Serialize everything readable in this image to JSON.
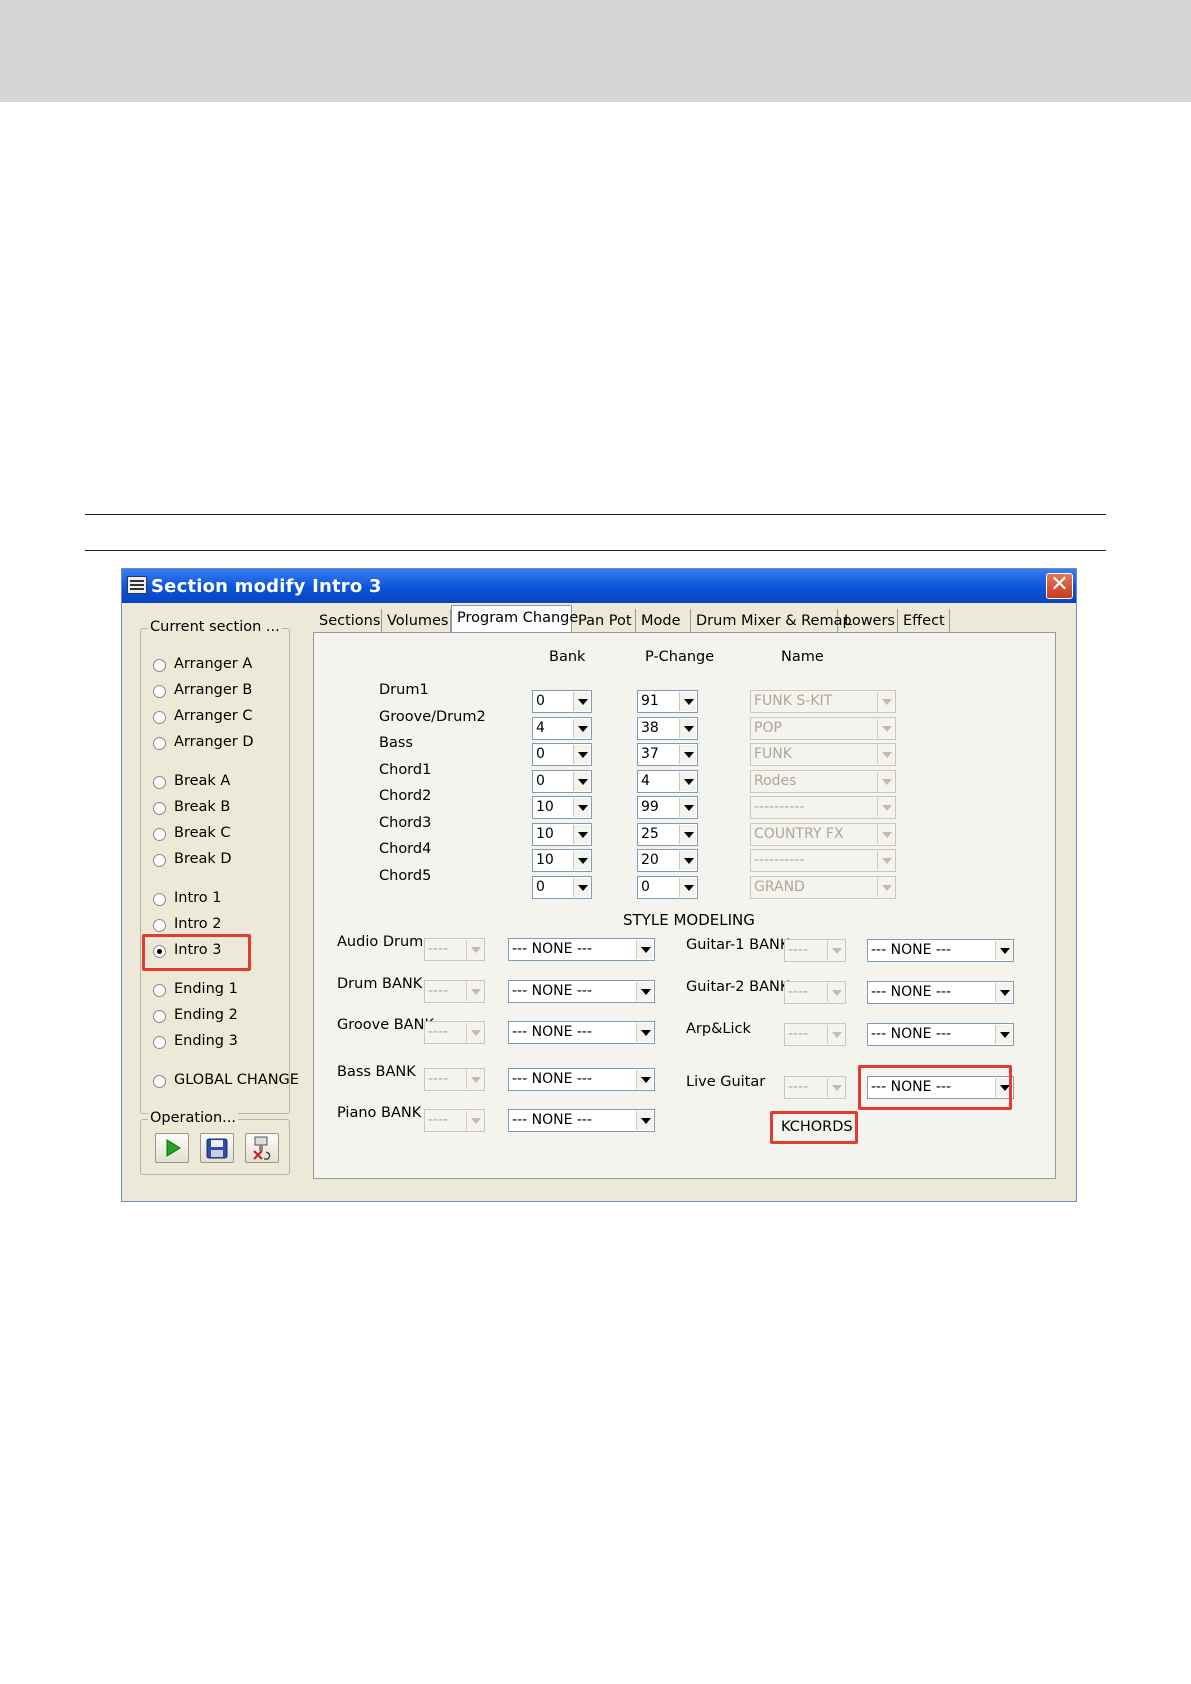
{
  "window": {
    "title": "Section modify Intro 3",
    "close_label": "✕"
  },
  "current_section": {
    "legend": "Current section ...",
    "selected": "Intro 3",
    "options": [
      "Arranger A",
      "Arranger B",
      "Arranger C",
      "Arranger D",
      "Break A",
      "Break B",
      "Break C",
      "Break D",
      "Intro 1",
      "Intro 2",
      "Intro 3",
      "Ending 1",
      "Ending 2",
      "Ending 3",
      "GLOBAL CHANGE"
    ]
  },
  "operation": {
    "legend": "Operation...",
    "buttons": [
      "play-icon",
      "save-icon",
      "delete-icon"
    ]
  },
  "tabs": [
    "Sections",
    "Volumes",
    "Program Change",
    "Pan Pot",
    "Mode",
    "Drum Mixer & Remap",
    "Lowers",
    "Effect"
  ],
  "active_tab": "Program Change",
  "program_change": {
    "headers": {
      "bank": "Bank",
      "pchange": "P-Change",
      "name": "Name"
    },
    "rows": [
      {
        "label": "Drum1",
        "bank": "0",
        "pchange": "91",
        "name": "FUNK S-KIT"
      },
      {
        "label": "Groove/Drum2",
        "bank": "4",
        "pchange": "38",
        "name": "POP"
      },
      {
        "label": "Bass",
        "bank": "0",
        "pchange": "37",
        "name": "FUNK"
      },
      {
        "label": "Chord1",
        "bank": "0",
        "pchange": "4",
        "name": "Rodes"
      },
      {
        "label": "Chord2",
        "bank": "10",
        "pchange": "99",
        "name": "----------"
      },
      {
        "label": "Chord3",
        "bank": "10",
        "pchange": "25",
        "name": "COUNTRY FX"
      },
      {
        "label": "Chord4",
        "bank": "10",
        "pchange": "20",
        "name": "----------"
      },
      {
        "label": "Chord5",
        "bank": "0",
        "pchange": "0",
        "name": "GRAND"
      }
    ]
  },
  "style_modeling": {
    "title": "STYLE MODELING",
    "left": [
      {
        "label": "Audio Drum",
        "small": "----",
        "value": "--- NONE ---"
      },
      {
        "label": "Drum BANK",
        "small": "----",
        "value": "--- NONE ---"
      },
      {
        "label": "Groove BANK",
        "small": "----",
        "value": "--- NONE ---"
      },
      {
        "label": "Bass BANK",
        "small": "----",
        "value": "--- NONE ---"
      },
      {
        "label": "Piano BANK",
        "small": "----",
        "value": "--- NONE ---"
      }
    ],
    "right": [
      {
        "label": "Guitar-1 BANK",
        "small": "----",
        "value": "--- NONE ---"
      },
      {
        "label": "Guitar-2 BANK",
        "small": "----",
        "value": "--- NONE ---"
      },
      {
        "label": "Arp&Lick",
        "small": "----",
        "value": "--- NONE ---"
      },
      {
        "label": "Live Guitar",
        "small": "----",
        "value": "--- NONE ---"
      }
    ],
    "kchords_label": "KCHORDS"
  },
  "colors": {
    "highlight": "#e53a2e",
    "titlebar": "#0a54d8",
    "window_bg": "#ece9d8"
  }
}
